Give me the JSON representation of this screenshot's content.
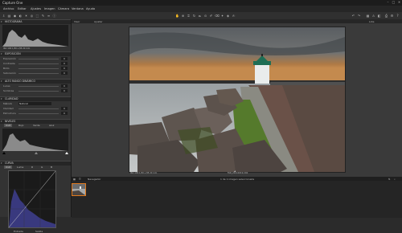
{
  "window": {
    "title": "Capture One",
    "min": "–",
    "max": "□",
    "close": "✕"
  },
  "menus": [
    "Archivo",
    "Editar",
    "Ajustes",
    "Imagen",
    "Cámara",
    "Ventana",
    "Ayuda"
  ],
  "viewer": {
    "name": "Visor",
    "zoom": "Ajustar",
    "status": "Lote",
    "meta_left": "ISO 100  1/30 s  f/8  20 mm",
    "meta_right": "FAR_20110219.CR2"
  },
  "left_panel": {
    "histogram": "HISTOGRAMA",
    "histogram_info": "ISO 100   1/30 s   f/8   20 mm",
    "exposure": {
      "title": "EXPOSICIÓN",
      "rows": [
        {
          "label": "Exposición",
          "value": "0"
        },
        {
          "label": "Contraste",
          "value": "0"
        },
        {
          "label": "Brillo",
          "value": "0"
        },
        {
          "label": "Saturación",
          "value": "0"
        }
      ]
    },
    "hdr": {
      "title": "ALTO RANGO DINÁMICO",
      "rows": [
        {
          "label": "Luces",
          "value": "0"
        },
        {
          "label": "Sombras",
          "value": "0"
        }
      ]
    },
    "clarity": {
      "title": "CLARIDAD",
      "method_label": "Método",
      "method_value": "Natural",
      "rows": [
        {
          "label": "Claridad",
          "value": "0"
        },
        {
          "label": "Estructura",
          "value": "0"
        }
      ]
    },
    "levels": {
      "title": "NIVELES",
      "tabs": [
        "RGB",
        "Rojo",
        "Verde",
        "Azul"
      ]
    },
    "curve": {
      "title": "CURVA",
      "tabs": [
        "RGB",
        "Luma",
        "R",
        "G",
        "B"
      ],
      "input_label": "Entrada",
      "output_label": "Salida"
    }
  },
  "browser": {
    "title": "Navegador",
    "count": "1 de 1 imagen seleccionada"
  }
}
